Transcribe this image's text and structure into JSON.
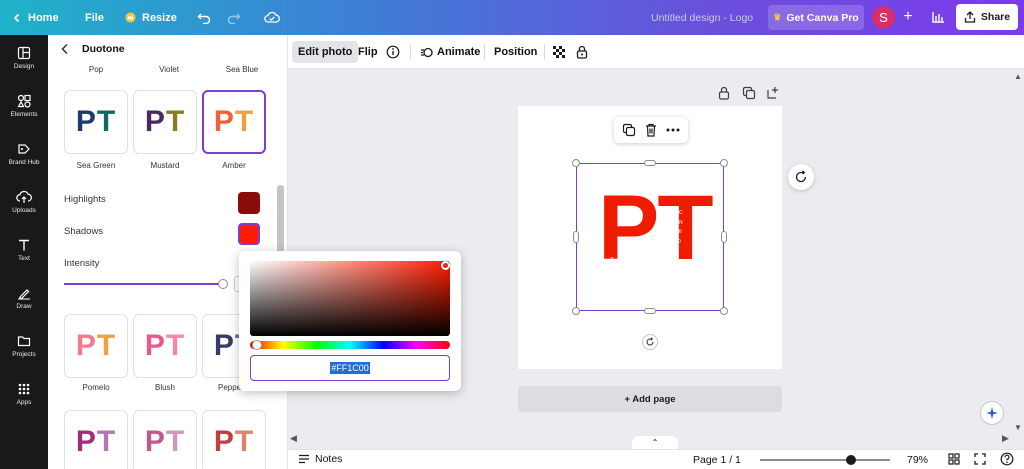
{
  "topbar": {
    "home_label": "Home",
    "file_label": "File",
    "resize_label": "Resize",
    "design_title": "Untitled design - Logo",
    "get_pro_label": "Get Canva Pro",
    "avatar_letter": "S",
    "share_label": "Share"
  },
  "sidebar": {
    "items": [
      {
        "label": "Design",
        "icon": "layout-icon"
      },
      {
        "label": "Elements",
        "icon": "shapes-icon"
      },
      {
        "label": "Brand Hub",
        "icon": "brand-icon"
      },
      {
        "label": "Uploads",
        "icon": "upload-cloud-icon"
      },
      {
        "label": "Text",
        "icon": "text-icon"
      },
      {
        "label": "Draw",
        "icon": "draw-icon"
      },
      {
        "label": "Projects",
        "icon": "folder-icon"
      },
      {
        "label": "Apps",
        "icon": "apps-grid-icon"
      }
    ]
  },
  "panel": {
    "title": "Duotone",
    "top_row_labels": [
      "Pop",
      "Violet",
      "Sea Blue"
    ],
    "row1": [
      {
        "label": "Sea Green",
        "left": "#1f3a6b",
        "right": "#0f6b60"
      },
      {
        "label": "Mustard",
        "left": "#4a2b5c",
        "right": "#8a7a2a"
      },
      {
        "label": "Amber",
        "left": "#f0603a",
        "right": "#f0a040"
      }
    ],
    "highlights_label": "Highlights",
    "highlights_color": "#8b0a0a",
    "shadows_label": "Shadows",
    "shadows_color": "#ff1c00",
    "intensity_label": "Intensity",
    "row2": [
      {
        "label": "Pomelo",
        "left": "#f77a8a",
        "right": "#f5a040"
      },
      {
        "label": "Blush",
        "left": "#e85a8a",
        "right": "#f08aa8"
      },
      {
        "label": "Pepper...",
        "left": "#3a3a6a",
        "right": "#6a6aa0"
      }
    ],
    "row3": [
      {
        "left": "#a0307a",
        "right": "#b07ab0"
      },
      {
        "left": "#c05a8a",
        "right": "#d098b8"
      },
      {
        "left": "#c04040",
        "right": "#e08070"
      }
    ]
  },
  "color_picker": {
    "hex_value": "#FF1C00",
    "hue_color": "#ff1c00"
  },
  "toolbar": {
    "edit_photo_label": "Edit photo",
    "flip_label": "Flip",
    "animate_label": "Animate",
    "position_label": "Position"
  },
  "canvas": {
    "logo_text": "PT",
    "logo_color": "#f01c00",
    "logo_vertical_text": "ECHNOID",
    "logo_small_text": "RO",
    "add_page_label": "+ Add page"
  },
  "bottombar": {
    "notes_label": "Notes",
    "page_indicator": "Page 1 / 1",
    "zoom_level": "79%",
    "zoom_fraction": 0.7
  }
}
